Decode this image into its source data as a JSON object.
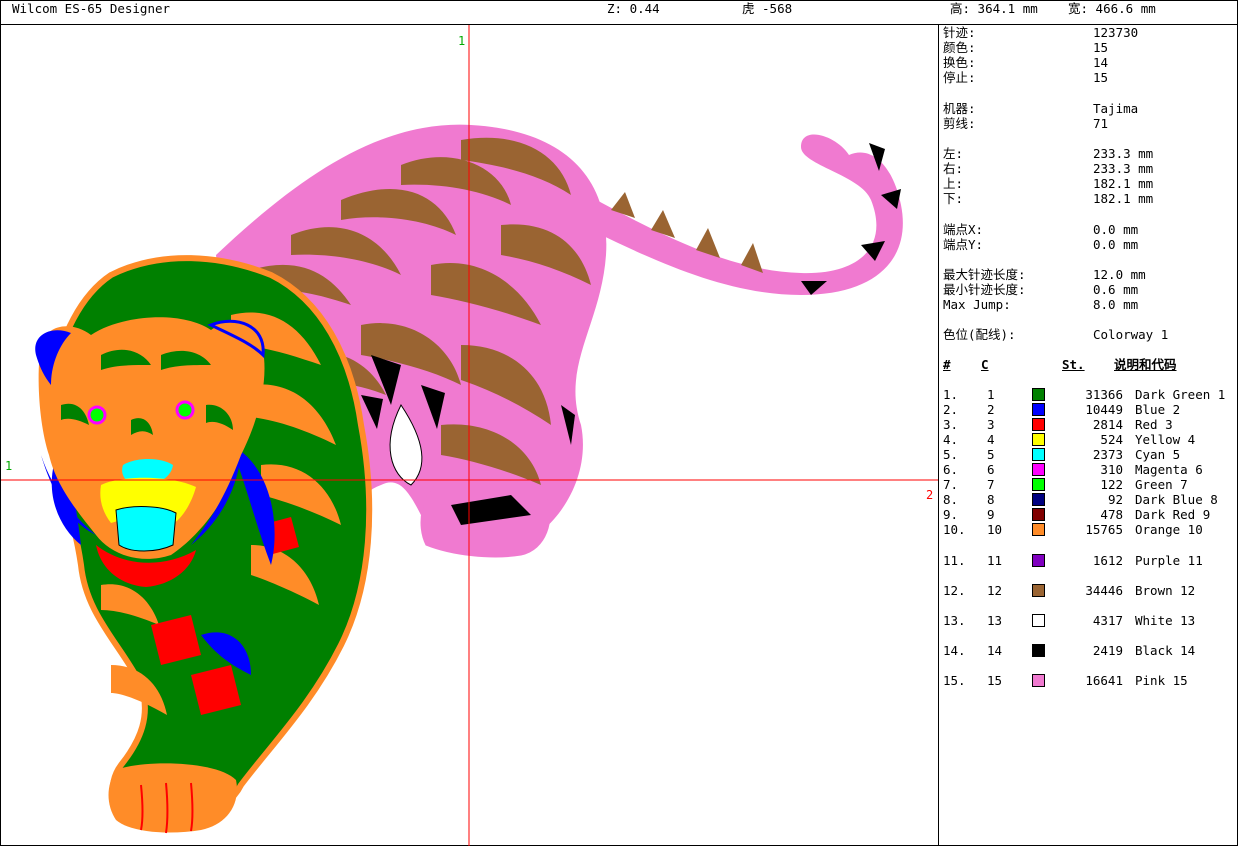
{
  "titlebar": {
    "app": "Wilcom ES-65 Designer",
    "zoom": "Z: 0.44",
    "design": "虎 -568",
    "height": "高: 364.1 mm",
    "width": "宽: 466.6 mm"
  },
  "canvas": {
    "guide_v_label": "1",
    "guide_h_label_left": "1",
    "guide_h_label_right": "2"
  },
  "stats": [
    {
      "key": "针迹:",
      "value": "123730"
    },
    {
      "key": "颜色:",
      "value": "15"
    },
    {
      "key": "换色:",
      "value": "14"
    },
    {
      "key": "停止:",
      "value": "15"
    },
    {
      "key": "机器:",
      "value": "Tajima"
    },
    {
      "key": "剪线:",
      "value": "71"
    },
    {
      "key": "左:",
      "value": "233.3 mm"
    },
    {
      "key": "右:",
      "value": "233.3 mm"
    },
    {
      "key": "上:",
      "value": "182.1 mm"
    },
    {
      "key": "下:",
      "value": "182.1 mm"
    },
    {
      "key": "端点X:",
      "value": "0.0 mm"
    },
    {
      "key": "端点Y:",
      "value": "0.0 mm"
    },
    {
      "key": "最大针迹长度:",
      "value": "12.0 mm"
    },
    {
      "key": "最小针迹长度:",
      "value": "0.6 mm"
    },
    {
      "key": "Max Jump:",
      "value": "8.0 mm"
    },
    {
      "key": "色位(配线):",
      "value": "Colorway 1"
    }
  ],
  "color_table": {
    "headers": {
      "num": "#",
      "code": "C",
      "stitches": "St.",
      "desc": "说明和代码"
    },
    "rows": [
      {
        "num": "1.",
        "code": "1",
        "color": "#008000",
        "stitches": "31366",
        "desc": "Dark Green 1"
      },
      {
        "num": "2.",
        "code": "2",
        "color": "#0000ff",
        "stitches": "10449",
        "desc": "Blue 2"
      },
      {
        "num": "3.",
        "code": "3",
        "color": "#ff0000",
        "stitches": "2814",
        "desc": "Red 3"
      },
      {
        "num": "4.",
        "code": "4",
        "color": "#ffff00",
        "stitches": "524",
        "desc": "Yellow 4"
      },
      {
        "num": "5.",
        "code": "5",
        "color": "#00ffff",
        "stitches": "2373",
        "desc": "Cyan 5"
      },
      {
        "num": "6.",
        "code": "6",
        "color": "#ff00ff",
        "stitches": "310",
        "desc": "Magenta 6"
      },
      {
        "num": "7.",
        "code": "7",
        "color": "#00ff00",
        "stitches": "122",
        "desc": "Green 7"
      },
      {
        "num": "8.",
        "code": "8",
        "color": "#000080",
        "stitches": "92",
        "desc": "Dark Blue 8"
      },
      {
        "num": "9.",
        "code": "9",
        "color": "#800000",
        "stitches": "478",
        "desc": "Dark Red 9"
      },
      {
        "num": "10.",
        "code": "10",
        "color": "#ff8c28",
        "stitches": "15765",
        "desc": "Orange 10"
      },
      {
        "num": "11.",
        "code": "11",
        "color": "#8000c0",
        "stitches": "1612",
        "desc": "Purple 11"
      },
      {
        "num": "12.",
        "code": "12",
        "color": "#9a6432",
        "stitches": "34446",
        "desc": "Brown 12"
      },
      {
        "num": "13.",
        "code": "13",
        "color": "#ffffff",
        "stitches": "4317",
        "desc": "White 13"
      },
      {
        "num": "14.",
        "code": "14",
        "color": "#000000",
        "stitches": "2419",
        "desc": "Black 14"
      },
      {
        "num": "15.",
        "code": "15",
        "color": "#f07ad0",
        "stitches": "16641",
        "desc": "Pink 15"
      }
    ]
  }
}
